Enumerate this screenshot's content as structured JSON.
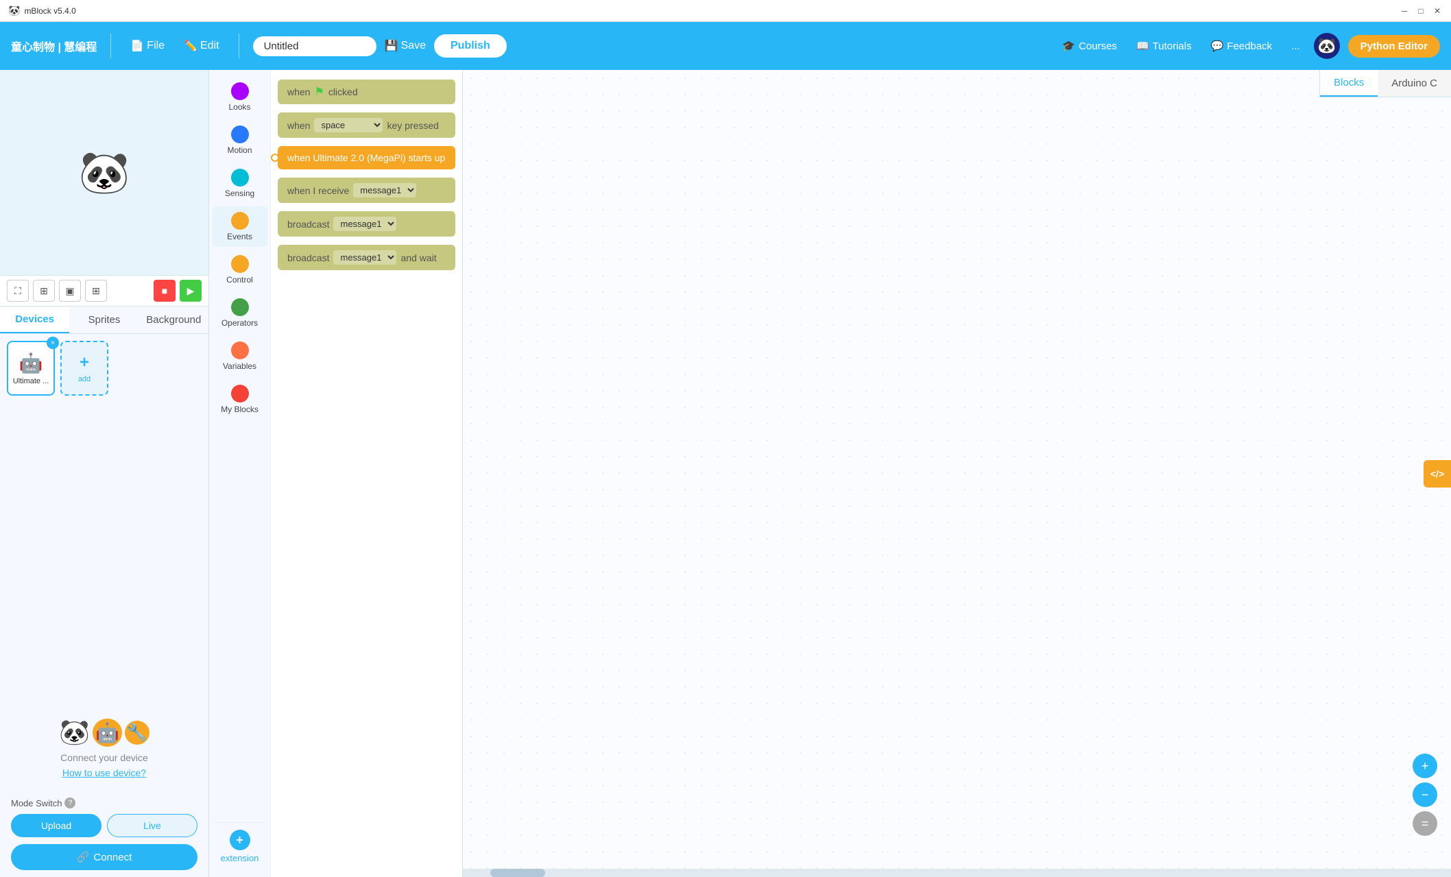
{
  "titlebar": {
    "app_name": "mBlock v5.4.0",
    "min_btn": "─",
    "max_btn": "□",
    "close_btn": "✕"
  },
  "toolbar": {
    "brand": "童心制物 | 慧编程",
    "file_label": "File",
    "edit_label": "Edit",
    "title_value": "Untitled",
    "save_label": "Save",
    "publish_label": "Publish",
    "courses_label": "Courses",
    "tutorials_label": "Tutorials",
    "feedback_label": "Feedback",
    "more_label": "...",
    "python_editor_label": "Python Editor"
  },
  "canvas_tabs": {
    "blocks_label": "Blocks",
    "arduino_label": "Arduino C"
  },
  "left": {
    "tabs": {
      "devices_label": "Devices",
      "sprites_label": "Sprites",
      "background_label": "Background"
    },
    "device_card": {
      "label": "Ultimate ...",
      "close": "×"
    },
    "add_label": "add",
    "connect_text": "Connect your device",
    "how_link": "How to use device?",
    "mode_switch_label": "Mode Switch",
    "upload_label": "Upload",
    "live_label": "Live",
    "connect_btn_label": "Connect"
  },
  "categories": [
    {
      "id": "looks",
      "label": "Looks",
      "color": "#aa00ff"
    },
    {
      "id": "motion",
      "label": "Motion",
      "color": "#2979ff"
    },
    {
      "id": "sensing",
      "label": "Sensing",
      "color": "#00bcd4"
    },
    {
      "id": "events",
      "label": "Events",
      "color": "#f5a623",
      "active": true
    },
    {
      "id": "control",
      "label": "Control",
      "color": "#f5a623"
    },
    {
      "id": "operators",
      "label": "Operators",
      "color": "#43a047"
    },
    {
      "id": "variables",
      "label": "Variables",
      "color": "#ff7043"
    },
    {
      "id": "my_blocks",
      "label": "My Blocks",
      "color": "#f44336"
    }
  ],
  "blocks": [
    {
      "id": "when_clicked",
      "type": "olive",
      "parts": [
        "when",
        "flag",
        "clicked"
      ]
    },
    {
      "id": "when_key",
      "type": "olive",
      "parts": [
        "when",
        "space",
        "key pressed"
      ]
    },
    {
      "id": "when_starts_up",
      "type": "orange_bright",
      "parts": [
        "when Ultimate 2.0  (MegaPi)  starts up"
      ]
    },
    {
      "id": "when_receive",
      "type": "olive",
      "parts": [
        "when I receive",
        "message1"
      ]
    },
    {
      "id": "broadcast",
      "type": "olive",
      "parts": [
        "broadcast",
        "message1"
      ]
    },
    {
      "id": "broadcast_wait",
      "type": "olive",
      "parts": [
        "broadcast",
        "message1",
        "and wait"
      ]
    }
  ],
  "extension": {
    "label": "extension"
  },
  "zoom": {
    "plus_label": "+",
    "minus_label": "−",
    "reset_label": "="
  },
  "code_toggle": {
    "label": "</>"
  }
}
